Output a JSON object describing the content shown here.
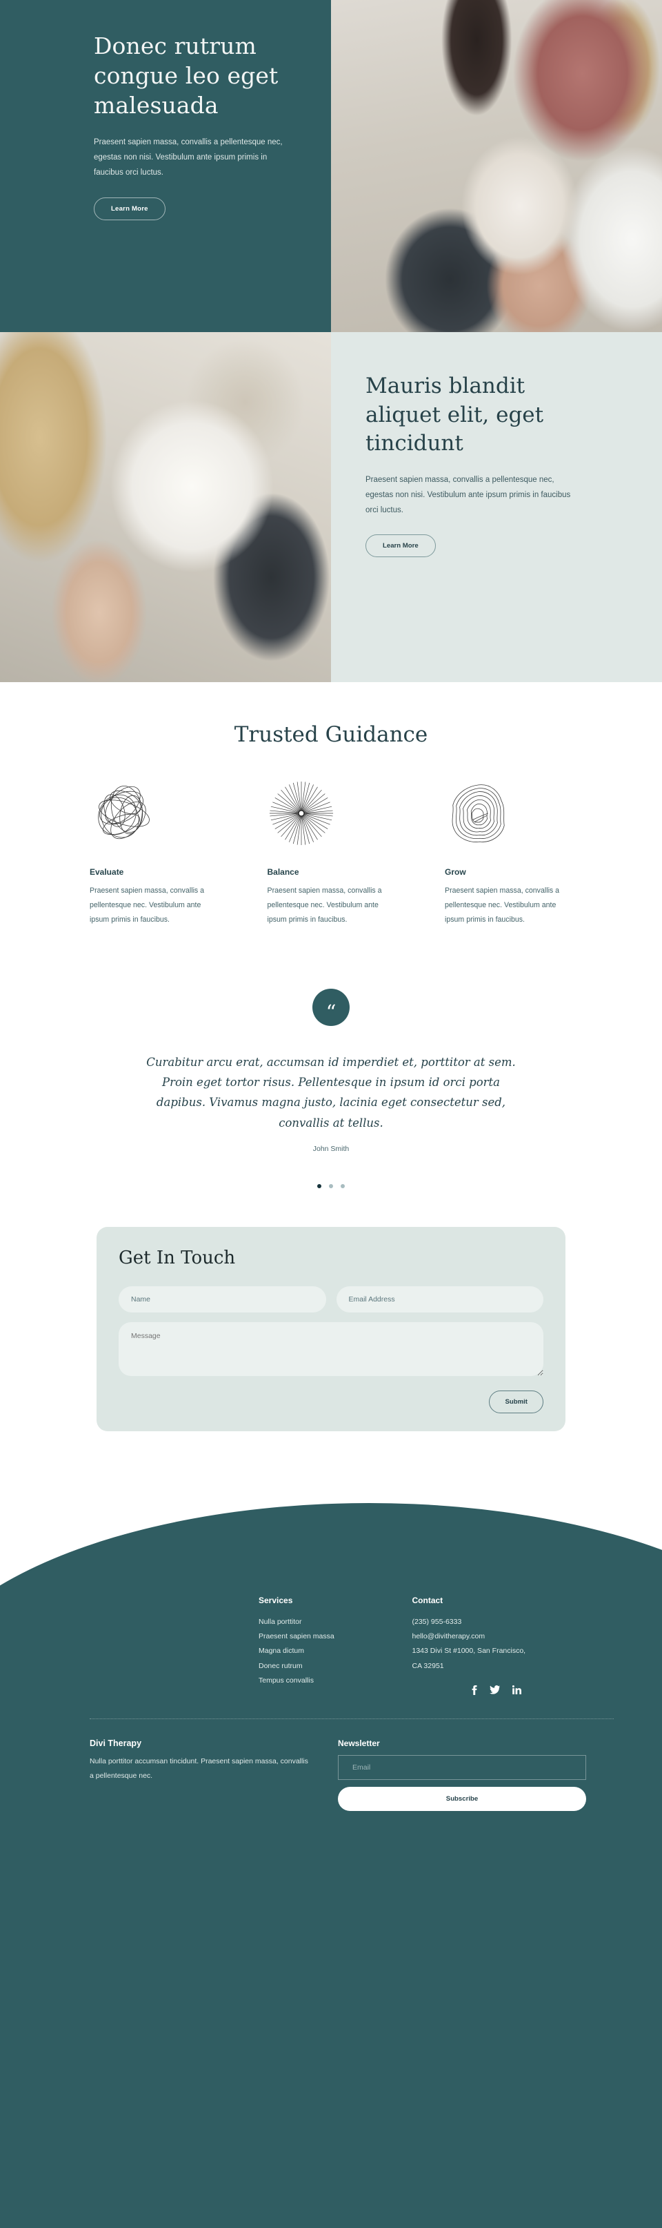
{
  "hero": {
    "title": "Donec rutrum congue leo eget malesuada",
    "body": "Praesent sapien massa, convallis a pellentesque nec, egestas non nisi. Vestibulum ante ipsum primis in faucibus orci luctus.",
    "cta": "Learn More",
    "bg_color": "#305D62",
    "image_alt": "therapy-session-photo"
  },
  "section2": {
    "title": "Mauris blandit aliquet elit, eget tincidunt",
    "body": "Praesent sapien massa, convallis a pellentesque nec, egestas non nisi. Vestibulum ante ipsum primis in faucibus orci luctus.",
    "cta": "Learn More",
    "bg_color": "#E0E8E6",
    "image_alt": "therapist-writing-notes-photo"
  },
  "guidance": {
    "title": "Trusted Guidance",
    "features": [
      {
        "icon": "scribble-loops-icon",
        "name": "Evaluate",
        "body": "Praesent sapien massa, convallis a pellentesque nec. Vestibulum ante ipsum primis in faucibus."
      },
      {
        "icon": "sunburst-radial-icon",
        "name": "Balance",
        "body": "Praesent sapien massa, convallis a pellentesque nec. Vestibulum ante ipsum primis in faucibus."
      },
      {
        "icon": "contour-rings-icon",
        "name": "Grow",
        "body": "Praesent sapien massa, convallis a pellentesque nec. Vestibulum ante ipsum primis in faucibus."
      }
    ]
  },
  "testimonial": {
    "badge_icon": "quote-icon",
    "badge_glyph": "“",
    "quote": "Curabitur arcu erat, accumsan id imperdiet et, porttitor at sem. Proin eget tortor risus. Pellentesque in ipsum id orci porta dapibus. Vivamus magna justo, lacinia eget consectetur sed, convallis at tellus.",
    "author": "John Smith",
    "slide_count": 3,
    "active_slide": 1
  },
  "contact": {
    "title": "Get In Touch",
    "name_placeholder": "Name",
    "email_placeholder": "Email Address",
    "message_placeholder": "Message",
    "submit_label": "Submit"
  },
  "footer": {
    "services": {
      "head": "Services",
      "items": [
        "Nulla porttitor",
        "Praesent sapien massa",
        "Magna dictum",
        "Donec rutrum",
        "Tempus convallis"
      ]
    },
    "contact": {
      "head": "Contact",
      "phone": "(235) 955-6333",
      "email": "hello@divitherapy.com",
      "address_line1": "1343 Divi St #1000, San Francisco,",
      "address_line2": "CA 32951"
    },
    "socials": [
      "facebook-icon",
      "twitter-icon",
      "linkedin-icon"
    ],
    "brand": {
      "title": "Divi Therapy",
      "body": "Nulla porttitor accumsan tincidunt. Praesent sapien massa, convallis a pellentesque nec."
    },
    "newsletter": {
      "head": "Newsletter",
      "email_placeholder": "Email",
      "subscribe_label": "Subscribe"
    },
    "bg_color": "#305D62"
  }
}
